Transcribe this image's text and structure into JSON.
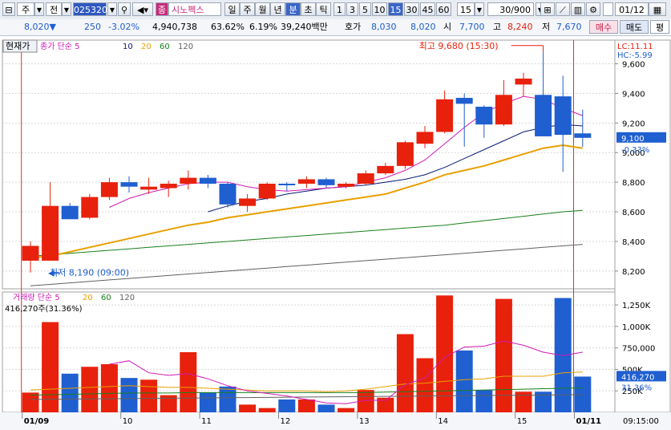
{
  "toolbar": {
    "market_type": "주",
    "period_prefix": "전",
    "stock_code": "025320",
    "stock_badge": "종",
    "stock_name": "시노펙스",
    "periods": [
      "일",
      "주",
      "월",
      "년",
      "분",
      "초",
      "틱"
    ],
    "period_selected": "분",
    "intervals": [
      "1",
      "3",
      "5",
      "10",
      "15",
      "30",
      "45",
      "60"
    ],
    "interval_selected": "15",
    "interval_value": "15",
    "count": "30/900",
    "date_value": "01/12"
  },
  "quote": {
    "price": "8,020",
    "direction": "▼",
    "change": "250",
    "change_pct": "-3.02%",
    "volume": "4,940,738",
    "ratio1": "63.62%",
    "ratio2": "6.19%",
    "amount": "39,240백만",
    "hoga_label": "호가",
    "hoga_ask": "8,030",
    "hoga_bid": "8,020",
    "open_label": "시",
    "open": "7,700",
    "high_label": "고",
    "high": "8,240",
    "low_label": "저",
    "low": "7,670",
    "buy_label": "매수",
    "sell_label": "매도",
    "extra_label": "평"
  },
  "colors": {
    "up": "#e8210c",
    "down": "#1f5fd0",
    "ma5": "#d01ab4",
    "ma10": "#0a1a70",
    "ma20": "#e8a000",
    "ma60": "#18801c",
    "ma120": "#606060",
    "label_blue": "#1f5fd0"
  },
  "chart_data": [
    {
      "type": "candlestick",
      "panel": "price",
      "tooltip": "현재가",
      "legend_prefix": "가격",
      "legend_name": "종가 단순",
      "ma_periods": [
        "5",
        "10",
        "20",
        "60",
        "120"
      ],
      "lc_label": "LC:11.11",
      "hc_label": "HC:-5.99",
      "y_ticks": [
        9600,
        9400,
        9200,
        9000,
        8800,
        8600,
        8400,
        8200
      ],
      "y_tick_labels": [
        "9,600",
        "9,400",
        "9,200",
        "9,000",
        "8,800",
        "8,600",
        "8,400",
        "8,200"
      ],
      "ylim": [
        8080,
        9760
      ],
      "current_price": "9,100",
      "current_pct": "-0.33%",
      "current_value": 9100,
      "max_annotation": "최고 9,680 (15:30)",
      "min_annotation": "최저 8,190 (09:00)",
      "x_labels": [
        {
          "i": 0,
          "label": "01/09",
          "bold": true
        },
        {
          "i": 5,
          "label": "10"
        },
        {
          "i": 9,
          "label": "11"
        },
        {
          "i": 13,
          "label": "12"
        },
        {
          "i": 17,
          "label": "13"
        },
        {
          "i": 21,
          "label": "14"
        },
        {
          "i": 25,
          "label": "15"
        },
        {
          "i": 28,
          "label": "01/11",
          "bold": true
        }
      ],
      "time_label": "09:15:00",
      "day_marker_indices": [
        0,
        28
      ],
      "candles": [
        {
          "o": 8270,
          "h": 8400,
          "l": 8190,
          "c": 8370
        },
        {
          "o": 8270,
          "h": 8800,
          "l": 8270,
          "c": 8640
        },
        {
          "o": 8640,
          "h": 8660,
          "l": 8560,
          "c": 8550
        },
        {
          "o": 8560,
          "h": 8720,
          "l": 8550,
          "c": 8700
        },
        {
          "o": 8700,
          "h": 8830,
          "l": 8680,
          "c": 8800
        },
        {
          "o": 8800,
          "h": 8840,
          "l": 8730,
          "c": 8770
        },
        {
          "o": 8750,
          "h": 8830,
          "l": 8720,
          "c": 8770
        },
        {
          "o": 8760,
          "h": 8810,
          "l": 8700,
          "c": 8790
        },
        {
          "o": 8790,
          "h": 8880,
          "l": 8750,
          "c": 8830
        },
        {
          "o": 8830,
          "h": 8850,
          "l": 8760,
          "c": 8790
        },
        {
          "o": 8790,
          "h": 8800,
          "l": 8630,
          "c": 8650
        },
        {
          "o": 8640,
          "h": 8720,
          "l": 8600,
          "c": 8690
        },
        {
          "o": 8690,
          "h": 8800,
          "l": 8680,
          "c": 8790
        },
        {
          "o": 8790,
          "h": 8800,
          "l": 8740,
          "c": 8780
        },
        {
          "o": 8790,
          "h": 8840,
          "l": 8760,
          "c": 8820
        },
        {
          "o": 8820,
          "h": 8830,
          "l": 8760,
          "c": 8780
        },
        {
          "o": 8770,
          "h": 8800,
          "l": 8760,
          "c": 8790
        },
        {
          "o": 8790,
          "h": 8880,
          "l": 8780,
          "c": 8860
        },
        {
          "o": 8860,
          "h": 8930,
          "l": 8850,
          "c": 8910
        },
        {
          "o": 8910,
          "h": 9080,
          "l": 8890,
          "c": 9070
        },
        {
          "o": 9060,
          "h": 9180,
          "l": 9030,
          "c": 9140
        },
        {
          "o": 9140,
          "h": 9420,
          "l": 9130,
          "c": 9360
        },
        {
          "o": 9370,
          "h": 9400,
          "l": 9040,
          "c": 9330
        },
        {
          "o": 9310,
          "h": 9320,
          "l": 9100,
          "c": 9190
        },
        {
          "o": 9190,
          "h": 9490,
          "l": 9180,
          "c": 9390
        },
        {
          "o": 9460,
          "h": 9540,
          "l": 9380,
          "c": 9500
        },
        {
          "o": 9390,
          "h": 9680,
          "l": 9330,
          "c": 9110
        },
        {
          "o": 9380,
          "h": 9520,
          "l": 8870,
          "c": 9120
        },
        {
          "o": 9130,
          "h": 9290,
          "l": 9040,
          "c": 9100
        }
      ],
      "ma5": [
        null,
        null,
        null,
        null,
        8630,
        8690,
        8730,
        8760,
        8790,
        8800,
        8800,
        8770,
        8750,
        8740,
        8750,
        8760,
        8770,
        8800,
        8830,
        8880,
        8950,
        9060,
        9170,
        9270,
        9330,
        9380,
        9360,
        9300,
        9250
      ],
      "ma10": [
        null,
        null,
        null,
        null,
        null,
        null,
        null,
        null,
        null,
        8600,
        8640,
        8670,
        8690,
        8720,
        8740,
        8760,
        8770,
        8780,
        8800,
        8820,
        8850,
        8900,
        8960,
        9020,
        9080,
        9140,
        9170,
        9190,
        9180
      ],
      "ma20": [
        8290,
        8300,
        8330,
        8360,
        8390,
        8420,
        8450,
        8480,
        8510,
        8530,
        8560,
        8580,
        8600,
        8620,
        8640,
        8660,
        8680,
        8700,
        8720,
        8760,
        8800,
        8850,
        8880,
        8910,
        8950,
        8990,
        9030,
        9050,
        9030
      ],
      "ma60": [
        8300,
        8310,
        8320,
        8330,
        8340,
        8350,
        8360,
        8370,
        8380,
        8390,
        8400,
        8410,
        8420,
        8430,
        8440,
        8450,
        8460,
        8470,
        8480,
        8490,
        8500,
        8510,
        8525,
        8540,
        8555,
        8570,
        8585,
        8600,
        8610
      ],
      "ma120": [
        8100,
        8110,
        8120,
        8130,
        8140,
        8150,
        8160,
        8170,
        8180,
        8190,
        8200,
        8210,
        8220,
        8230,
        8240,
        8250,
        8260,
        8270,
        8280,
        8290,
        8300,
        8310,
        8320,
        8330,
        8340,
        8350,
        8360,
        8370,
        8380
      ]
    },
    {
      "type": "bar",
      "panel": "volume",
      "legend_name": "거래량",
      "legend_ma": "단순",
      "ma_periods": [
        "5",
        "20",
        "60",
        "120"
      ],
      "subtitle": "416,270주(31.36%)",
      "current_value_label": "416,270",
      "current_pct": "31.36%",
      "current_value": 416270,
      "y_ticks": [
        250000,
        500000,
        750000,
        1000000,
        1250000
      ],
      "y_tick_labels": [
        "250K",
        "500K",
        "750,000",
        "1,000K",
        "1,250K"
      ],
      "ylim": [
        0,
        1400000
      ],
      "values": [
        230000,
        1050000,
        450000,
        530000,
        560000,
        400000,
        380000,
        200000,
        700000,
        230000,
        300000,
        90000,
        50000,
        150000,
        150000,
        90000,
        50000,
        260000,
        170000,
        910000,
        630000,
        1360000,
        720000,
        260000,
        1320000,
        240000,
        240000,
        1330000,
        416270
      ],
      "ma5": [
        null,
        null,
        null,
        null,
        560000,
        600000,
        460000,
        430000,
        450000,
        390000,
        310000,
        250000,
        220000,
        190000,
        150000,
        110000,
        100000,
        140000,
        140000,
        320000,
        400000,
        640000,
        760000,
        770000,
        830000,
        780000,
        700000,
        660000,
        700000
      ],
      "ma20": [
        260000,
        270000,
        280000,
        290000,
        300000,
        310000,
        300000,
        290000,
        290000,
        280000,
        270000,
        260000,
        250000,
        250000,
        250000,
        240000,
        250000,
        270000,
        300000,
        330000,
        340000,
        360000,
        380000,
        390000,
        420000,
        420000,
        420000,
        460000,
        470000
      ],
      "ma60": [
        200000,
        205000,
        210000,
        215000,
        220000,
        225000,
        225000,
        225000,
        230000,
        230000,
        230000,
        230000,
        230000,
        230000,
        230000,
        230000,
        230000,
        230000,
        235000,
        240000,
        245000,
        250000,
        255000,
        260000,
        265000,
        270000,
        275000,
        280000,
        285000
      ],
      "ma120": [
        150000,
        152000,
        154000,
        156000,
        158000,
        160000,
        162000,
        164000,
        166000,
        168000,
        170000,
        172000,
        174000,
        176000,
        178000,
        180000,
        182000,
        184000,
        186000,
        188000,
        190000,
        192000,
        194000,
        196000,
        198000,
        200000,
        202000,
        204000,
        206000
      ]
    }
  ]
}
